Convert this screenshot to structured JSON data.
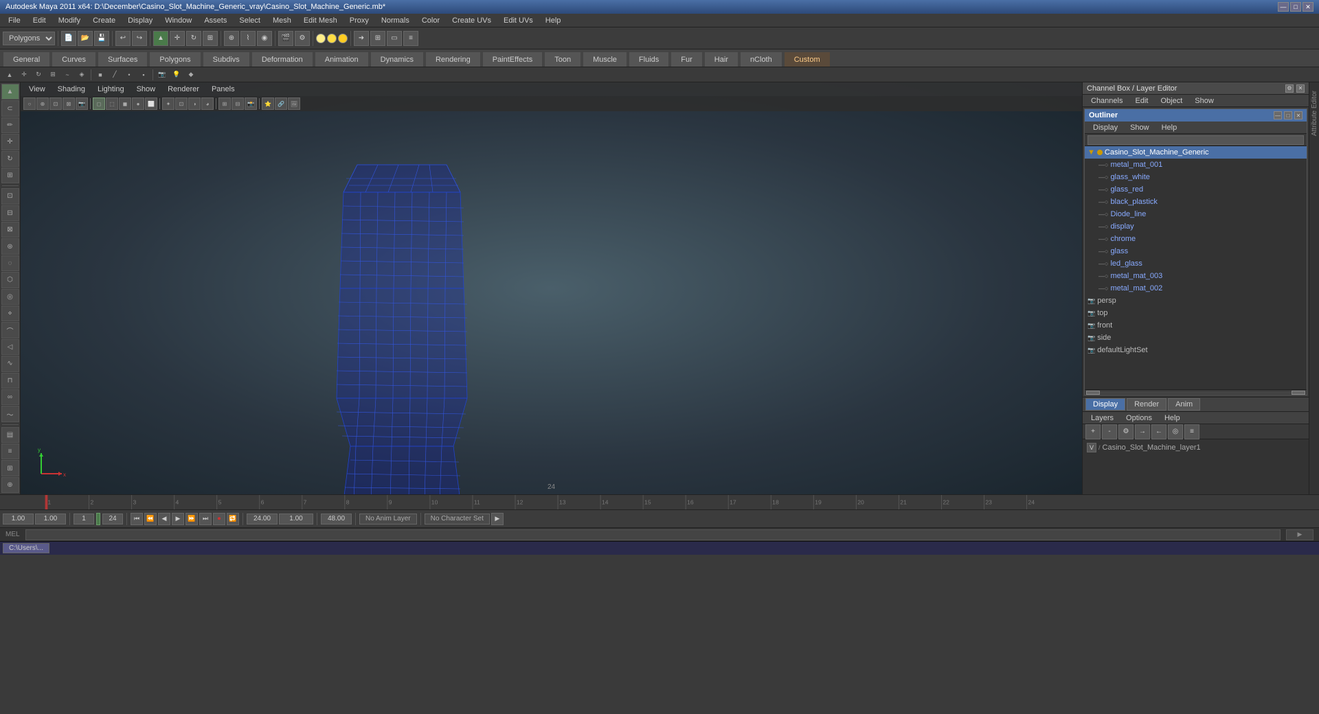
{
  "title_bar": {
    "title": "Autodesk Maya 2011 x64: D:\\December\\Casino_Slot_Machine_Generic_vray\\Casino_Slot_Machine_Generic.mb*",
    "min_btn": "—",
    "max_btn": "□",
    "close_btn": "✕"
  },
  "menu_bar": {
    "items": [
      "File",
      "Edit",
      "Modify",
      "Create",
      "Display",
      "Window",
      "Assets",
      "Select",
      "Mesh",
      "Edit Mesh",
      "Proxy",
      "Normals",
      "Color",
      "Create UVs",
      "Edit UVs",
      "Help"
    ]
  },
  "toolbar": {
    "mode_select": "Polygons",
    "buttons": [
      "💾",
      "📂",
      "🔒",
      "↩",
      "↪",
      "✂",
      "📋",
      "⬜",
      "🔲",
      "⚙"
    ]
  },
  "tabs": {
    "items": [
      "General",
      "Curves",
      "Surfaces",
      "Polygons",
      "Subdivs",
      "Deformation",
      "Animation",
      "Dynamics",
      "Rendering",
      "PaintEffects",
      "Toon",
      "Muscle",
      "Fluids",
      "Fur",
      "Hair",
      "nCloth",
      "Custom"
    ],
    "active": "Custom"
  },
  "viewport_menu": {
    "items": [
      "View",
      "Shading",
      "Lighting",
      "Show",
      "Renderer",
      "Panels"
    ]
  },
  "outliner": {
    "title": "Outliner",
    "menu_items": [
      "Display",
      "Show",
      "Help"
    ],
    "items": [
      {
        "name": "Casino_Slot_Machine_Generic",
        "type": "root",
        "expanded": true,
        "indent": 0
      },
      {
        "name": "metal_mat_001",
        "type": "mesh",
        "indent": 1
      },
      {
        "name": "glass_white",
        "type": "mesh",
        "indent": 1
      },
      {
        "name": "glass_red",
        "type": "mesh",
        "indent": 1
      },
      {
        "name": "black_plastick",
        "type": "mesh",
        "indent": 1
      },
      {
        "name": "Diode_line",
        "type": "mesh",
        "indent": 1
      },
      {
        "name": "display",
        "type": "mesh",
        "indent": 1
      },
      {
        "name": "chrome",
        "type": "mesh",
        "indent": 1
      },
      {
        "name": "glass",
        "type": "mesh",
        "indent": 1
      },
      {
        "name": "led_glass",
        "type": "mesh",
        "indent": 1
      },
      {
        "name": "metal_mat_003",
        "type": "mesh",
        "indent": 1
      },
      {
        "name": "metal_mat_002",
        "type": "mesh",
        "indent": 1
      },
      {
        "name": "persp",
        "type": "camera",
        "indent": 0
      },
      {
        "name": "top",
        "type": "camera",
        "indent": 0
      },
      {
        "name": "front",
        "type": "camera",
        "indent": 0
      },
      {
        "name": "side",
        "type": "camera",
        "indent": 0
      },
      {
        "name": "defaultLightSet",
        "type": "set",
        "indent": 0
      }
    ]
  },
  "channel_box": {
    "title": "Channel Box / Layer Editor",
    "menu_items": [
      "Channels",
      "Edit",
      "Object",
      "Show"
    ]
  },
  "layer_tabs": [
    "Display",
    "Render",
    "Anim"
  ],
  "layer_editor": {
    "menu_items": [
      "Layers",
      "Options",
      "Help"
    ],
    "layer_name": "Casino_Slot_Machine_layer1"
  },
  "timeline": {
    "start": "1.00",
    "end": "24.00",
    "current": "1.00",
    "ticks": [
      "1",
      "2",
      "3",
      "4",
      "5",
      "6",
      "7",
      "8",
      "9",
      "10",
      "11",
      "12",
      "13",
      "14",
      "15",
      "16",
      "17",
      "18",
      "19",
      "20",
      "21",
      "22",
      "23",
      "24"
    ],
    "range_start": "1.00",
    "range_end": "24.00",
    "anim_range_end": "48.00"
  },
  "bottom_controls": {
    "current_frame": "1.00",
    "range_start": "1.00",
    "playback_start": "1",
    "playback_end": "24",
    "range_end": "24.00",
    "anim_end": "48.00",
    "anim_layer": "No Anim Layer",
    "character_set": "No Character Set",
    "transport_btns": [
      "⏮",
      "⏪",
      "▶",
      "⏩",
      "⏭",
      "⏺",
      "🔁"
    ]
  },
  "status_bar": {
    "mel_label": "MEL",
    "command_input": "",
    "right_text": ""
  },
  "taskbar": {
    "buttons": [
      "C:\\Users\\..."
    ]
  },
  "frame_label": "24",
  "axes": {
    "x_color": "#cc3333",
    "y_color": "#33cc33",
    "z_color": "#3333cc"
  }
}
